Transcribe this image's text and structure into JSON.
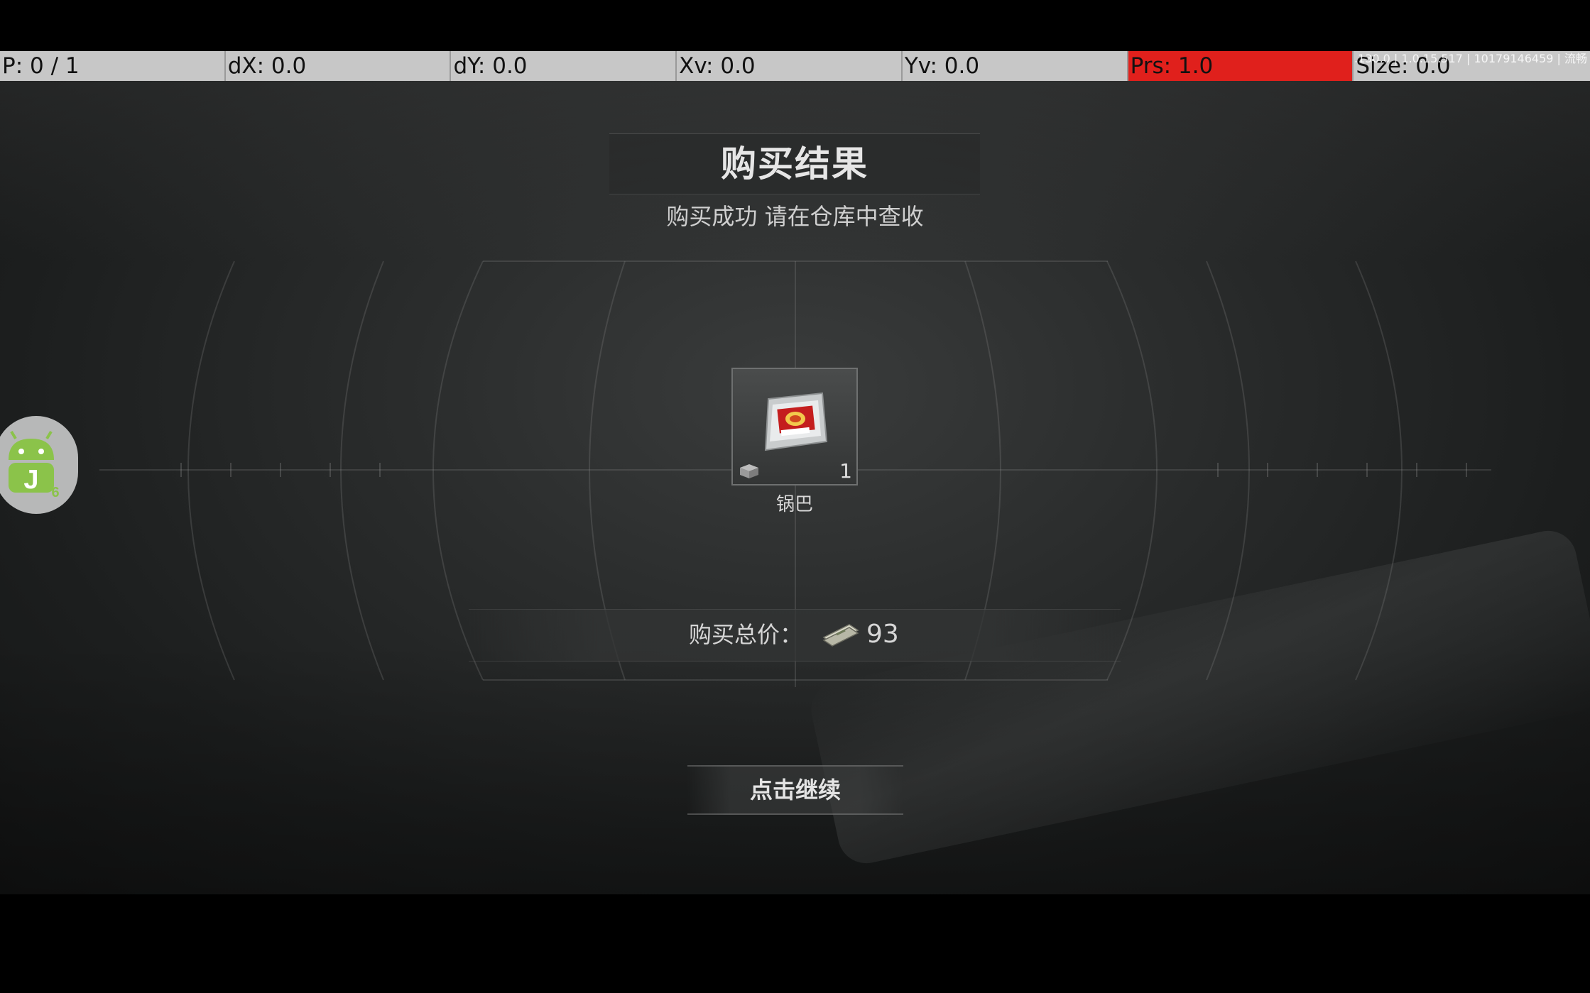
{
  "debug_bar": {
    "pointer": "P: 0 / 1",
    "dx": "dX: 0.0",
    "dy": "dY: 0.0",
    "xv": "Xv: 0.0",
    "yv": "Yv: 0.0",
    "prs": "Prs: 1.0",
    "size": "Size: 0.0",
    "build_info": "1.0.15.130.0 | 1.0.15.517 | 10179146459 | 流畅",
    "prs_color": "#e0201c"
  },
  "dialog": {
    "title": "购买结果",
    "subtitle": "购买成功 请在仓库中查收"
  },
  "item": {
    "name": "锅巴",
    "quantity": "1",
    "icon": "snack-bag-icon",
    "badge_icon": "box-icon"
  },
  "total": {
    "label": "购买总价：",
    "currency_icon": "cash-icon",
    "value": "93"
  },
  "continue_button": {
    "label": "点击继续"
  },
  "floating_widget": {
    "icon": "android-j-icon",
    "badge": "6"
  }
}
